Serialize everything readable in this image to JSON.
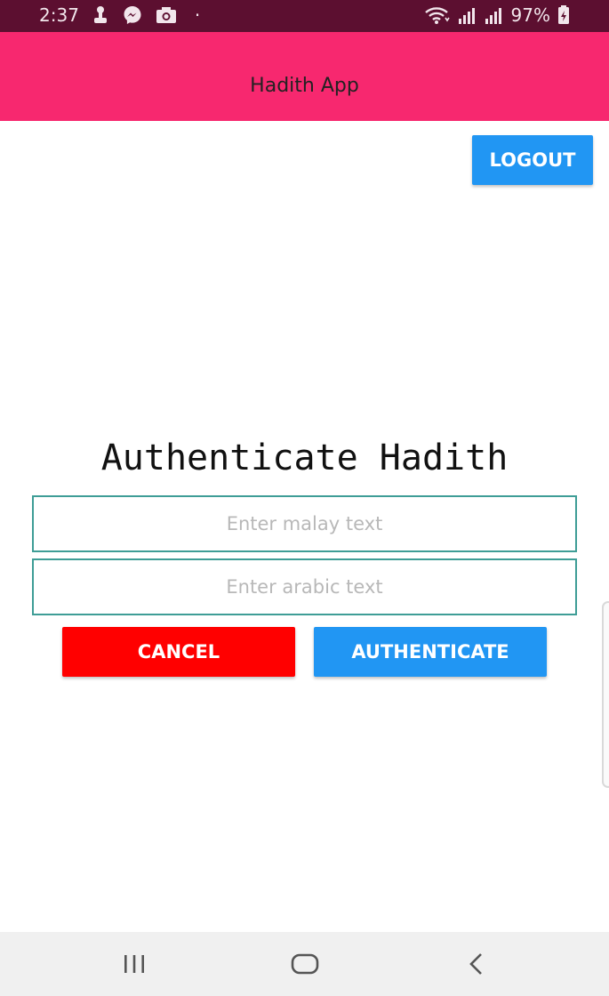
{
  "status_bar": {
    "time": "2:37",
    "battery_percent": "97%",
    "left_icons": [
      "usb-icon",
      "messenger-icon",
      "camera-icon",
      "dot-icon"
    ],
    "right_icons": [
      "wifi-icon",
      "signal-icon",
      "signal-icon",
      "battery-icon"
    ]
  },
  "app_bar": {
    "title": "Hadith App",
    "color": "#f7286f"
  },
  "header": {
    "logout_label": "LOGOUT"
  },
  "main": {
    "heading": "Authenticate Hadith",
    "malay_placeholder": "Enter malay text",
    "arabic_placeholder": "Enter arabic text",
    "cancel_label": "CANCEL",
    "authenticate_label": "AUTHENTICATE"
  },
  "colors": {
    "status_bar": "#5c0f30",
    "primary_button": "#2196f3",
    "cancel_button": "#ff0000",
    "input_border": "#3e9d96"
  },
  "nav_bar": {
    "icons": [
      "recents-icon",
      "home-icon",
      "back-icon"
    ]
  }
}
